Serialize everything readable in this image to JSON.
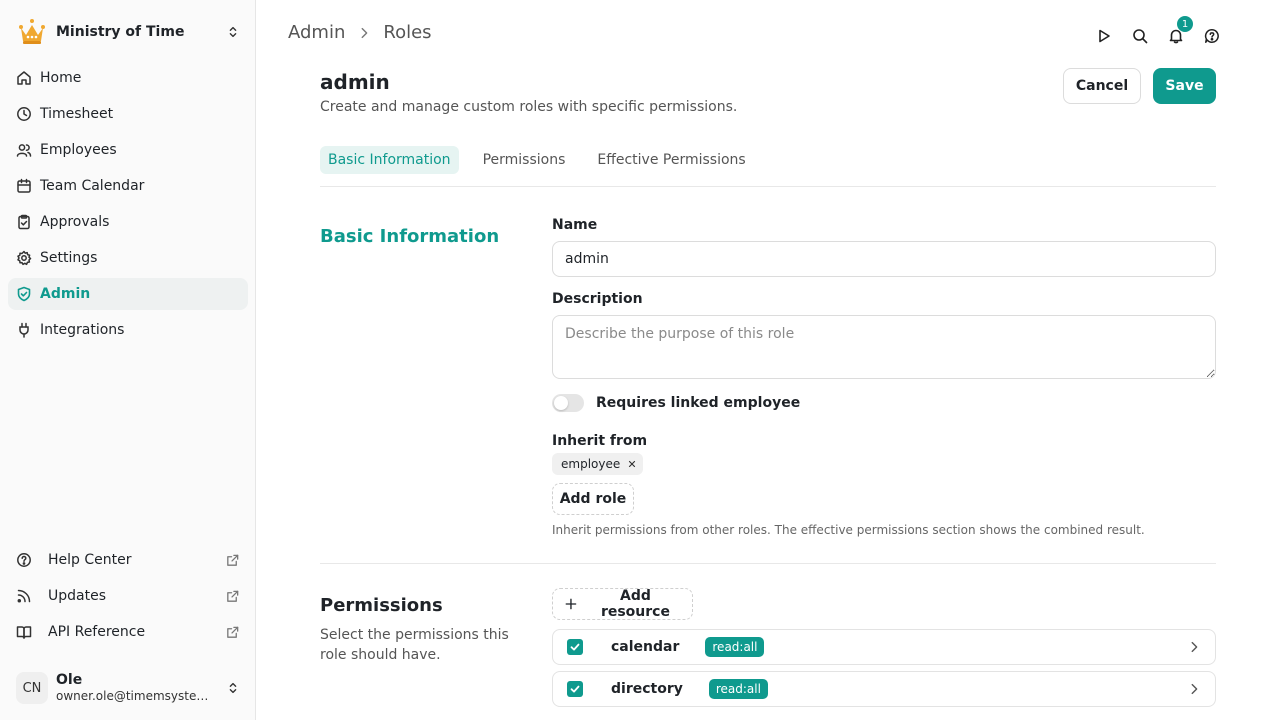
{
  "org": {
    "name": "Ministry of Time"
  },
  "nav": {
    "home": "Home",
    "timesheet": "Timesheet",
    "employees": "Employees",
    "team_calendar": "Team Calendar",
    "approvals": "Approvals",
    "settings": "Settings",
    "admin": "Admin",
    "integrations": "Integrations"
  },
  "bottom_nav": {
    "help_center": "Help Center",
    "updates": "Updates",
    "api_reference": "API Reference"
  },
  "user": {
    "initials": "CN",
    "name": "Ole",
    "email": "owner.ole@timemsystem...."
  },
  "breadcrumb": {
    "parent": "Admin",
    "current": "Roles"
  },
  "notifications": {
    "count": "1"
  },
  "page": {
    "title": "admin",
    "subtitle": "Create and manage custom roles with specific permissions.",
    "cancel_label": "Cancel",
    "save_label": "Save"
  },
  "tabs": {
    "basic": "Basic Information",
    "permissions": "Permissions",
    "effective": "Effective Permissions"
  },
  "basic_section": {
    "title": "Basic Information",
    "name_label": "Name",
    "name_value": "admin",
    "description_label": "Description",
    "description_placeholder": "Describe the purpose of this role",
    "description_value": "",
    "toggle_label": "Requires linked employee",
    "toggle_on": false,
    "inherit_label": "Inherit from",
    "inherit_chip": "employee",
    "add_role_label": "Add role",
    "hint": "Inherit permissions from other roles. The effective permissions section shows the combined result."
  },
  "permissions_section": {
    "title": "Permissions",
    "description": "Select the permissions this role should have.",
    "add_resource_label": "Add resource",
    "resources": [
      {
        "name": "calendar",
        "badge": "read:all",
        "checked": true
      },
      {
        "name": "directory",
        "badge": "read:all",
        "checked": true
      }
    ]
  },
  "colors": {
    "accent": "#0f9a8e",
    "accent_light": "#e6f4f2",
    "crown": "#f0a830"
  }
}
